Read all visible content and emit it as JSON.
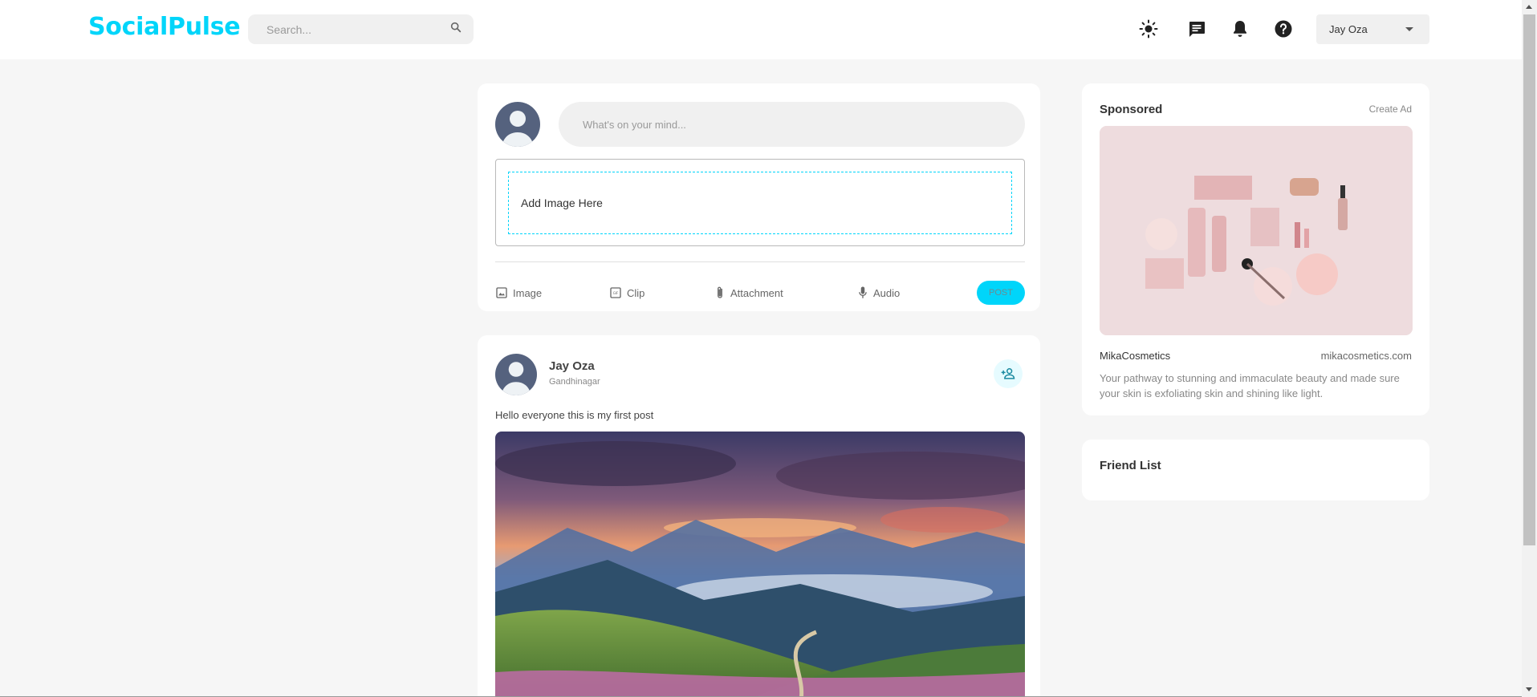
{
  "app": {
    "logo": "SocialPulse",
    "accent_color": "#00d5fa"
  },
  "navbar": {
    "search_placeholder": "Search...",
    "icons": [
      "sun-icon",
      "message-icon",
      "bell-icon",
      "help-icon"
    ],
    "user_name": "Jay Oza"
  },
  "composer": {
    "input_placeholder": "What's on your mind...",
    "dropzone_label": "Add Image Here",
    "actions": [
      {
        "label": "Image",
        "icon": "image-icon"
      },
      {
        "label": "Clip",
        "icon": "gif-icon"
      },
      {
        "label": "Attachment",
        "icon": "paperclip-icon"
      },
      {
        "label": "Audio",
        "icon": "microphone-icon"
      }
    ],
    "post_label": "POST"
  },
  "post": {
    "author": "Jay Oza",
    "location": "Gandhinagar",
    "text": "Hello everyone this is my first post"
  },
  "sponsored": {
    "title": "Sponsored",
    "create_ad": "Create Ad",
    "advertiser": "MikaCosmetics",
    "url": "mikacosmetics.com",
    "description": "Your pathway to stunning and immaculate beauty and made sure your skin is exfoliating skin and shining like light."
  },
  "friends": {
    "title": "Friend List"
  }
}
